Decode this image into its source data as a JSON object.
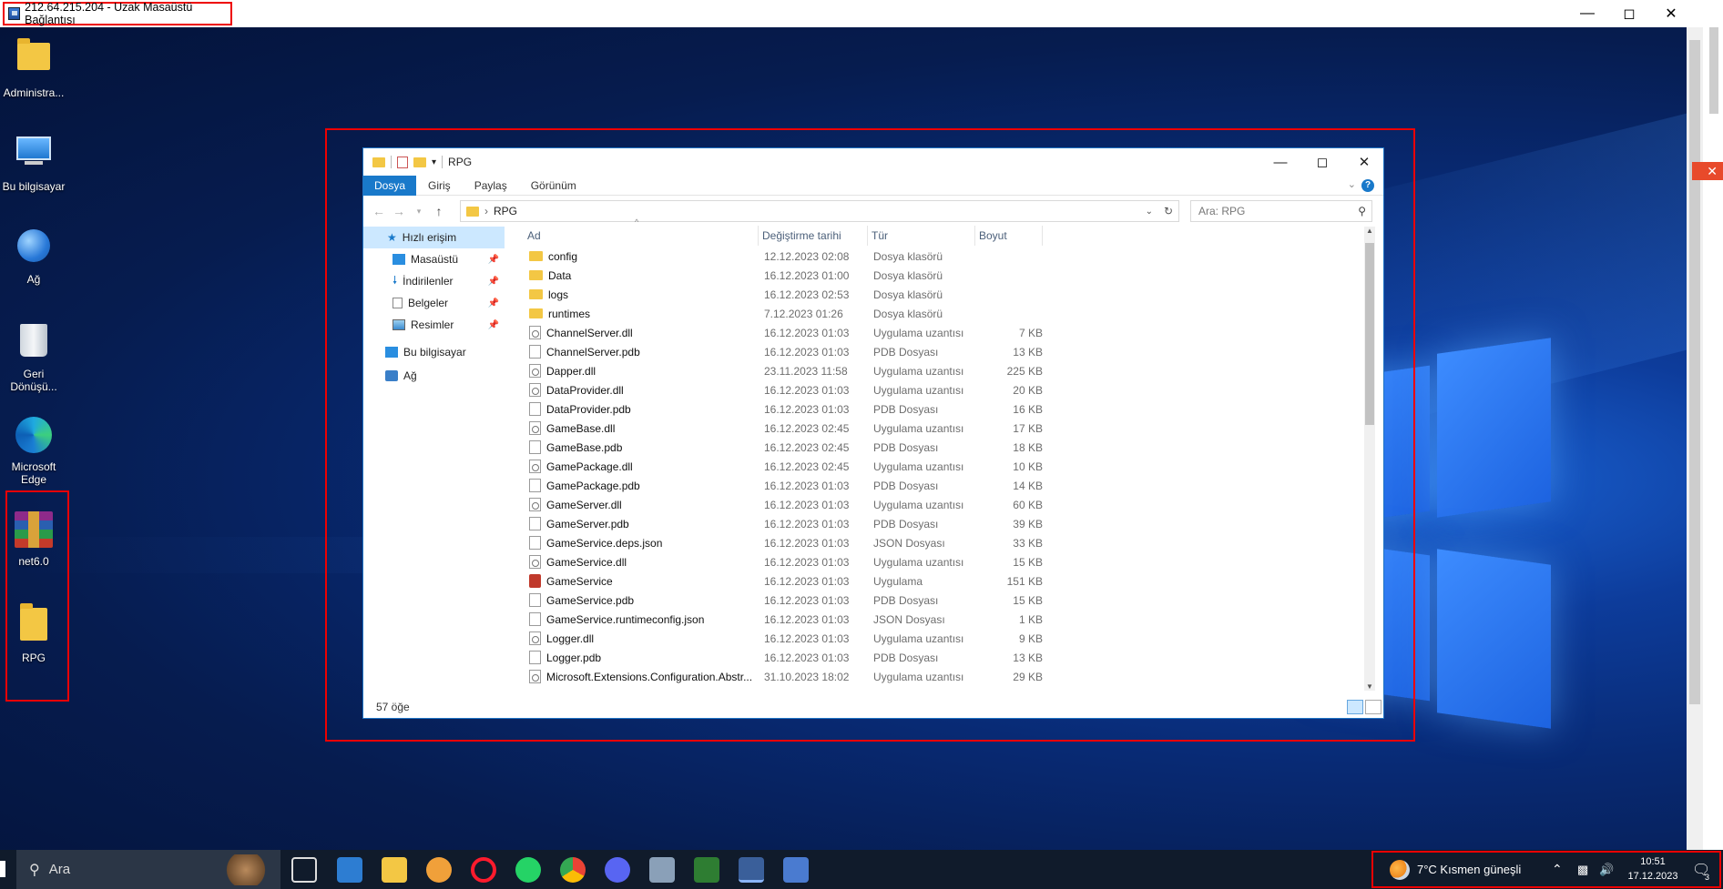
{
  "rdp": {
    "title": "212.64.215.204 - Uzak Masaüstü Bağlantısı"
  },
  "desktop": {
    "icons": [
      {
        "label": "Administra...",
        "icon": "user-folder-icon"
      },
      {
        "label": "Bu bilgisayar",
        "icon": "computer-icon"
      },
      {
        "label": "Ağ",
        "icon": "network-globe-icon"
      },
      {
        "label": "Geri Dönüşü...",
        "icon": "recycle-bin-icon"
      },
      {
        "label": "Microsoft Edge",
        "icon": "edge-icon"
      },
      {
        "label": "net6.0",
        "icon": "winrar-archive-icon"
      },
      {
        "label": "RPG",
        "icon": "folder-icon"
      }
    ]
  },
  "explorer": {
    "title": "RPG",
    "ribbon_tabs": [
      "Dosya",
      "Giriş",
      "Paylaş",
      "Görünüm"
    ],
    "address": "RPG",
    "search_placeholder": "Ara: RPG",
    "nav": {
      "quick_access": "Hızlı erişim",
      "desktop": "Masaüstü",
      "downloads": "İndirilenler",
      "documents": "Belgeler",
      "pictures": "Resimler",
      "this_pc": "Bu bilgisayar",
      "network": "Ağ"
    },
    "columns": {
      "name": "Ad",
      "date": "Değiştirme tarihi",
      "type": "Tür",
      "size": "Boyut"
    },
    "files": [
      {
        "name": "config",
        "date": "12.12.2023 02:08",
        "type": "Dosya klasörü",
        "size": "",
        "kind": "folder"
      },
      {
        "name": "Data",
        "date": "16.12.2023 01:00",
        "type": "Dosya klasörü",
        "size": "",
        "kind": "folder"
      },
      {
        "name": "logs",
        "date": "16.12.2023 02:53",
        "type": "Dosya klasörü",
        "size": "",
        "kind": "folder"
      },
      {
        "name": "runtimes",
        "date": "7.12.2023 01:26",
        "type": "Dosya klasörü",
        "size": "",
        "kind": "folder"
      },
      {
        "name": "ChannelServer.dll",
        "date": "16.12.2023 01:03",
        "type": "Uygulama uzantısı",
        "size": "7 KB",
        "kind": "dll"
      },
      {
        "name": "ChannelServer.pdb",
        "date": "16.12.2023 01:03",
        "type": "PDB Dosyası",
        "size": "13 KB",
        "kind": "file"
      },
      {
        "name": "Dapper.dll",
        "date": "23.11.2023 11:58",
        "type": "Uygulama uzantısı",
        "size": "225 KB",
        "kind": "dll"
      },
      {
        "name": "DataProvider.dll",
        "date": "16.12.2023 01:03",
        "type": "Uygulama uzantısı",
        "size": "20 KB",
        "kind": "dll"
      },
      {
        "name": "DataProvider.pdb",
        "date": "16.12.2023 01:03",
        "type": "PDB Dosyası",
        "size": "16 KB",
        "kind": "file"
      },
      {
        "name": "GameBase.dll",
        "date": "16.12.2023 02:45",
        "type": "Uygulama uzantısı",
        "size": "17 KB",
        "kind": "dll"
      },
      {
        "name": "GameBase.pdb",
        "date": "16.12.2023 02:45",
        "type": "PDB Dosyası",
        "size": "18 KB",
        "kind": "file"
      },
      {
        "name": "GamePackage.dll",
        "date": "16.12.2023 02:45",
        "type": "Uygulama uzantısı",
        "size": "10 KB",
        "kind": "dll"
      },
      {
        "name": "GamePackage.pdb",
        "date": "16.12.2023 01:03",
        "type": "PDB Dosyası",
        "size": "14 KB",
        "kind": "file"
      },
      {
        "name": "GameServer.dll",
        "date": "16.12.2023 01:03",
        "type": "Uygulama uzantısı",
        "size": "60 KB",
        "kind": "dll"
      },
      {
        "name": "GameServer.pdb",
        "date": "16.12.2023 01:03",
        "type": "PDB Dosyası",
        "size": "39 KB",
        "kind": "file"
      },
      {
        "name": "GameService.deps.json",
        "date": "16.12.2023 01:03",
        "type": "JSON Dosyası",
        "size": "33 KB",
        "kind": "file"
      },
      {
        "name": "GameService.dll",
        "date": "16.12.2023 01:03",
        "type": "Uygulama uzantısı",
        "size": "15 KB",
        "kind": "dll"
      },
      {
        "name": "GameService",
        "date": "16.12.2023 01:03",
        "type": "Uygulama",
        "size": "151 KB",
        "kind": "app"
      },
      {
        "name": "GameService.pdb",
        "date": "16.12.2023 01:03",
        "type": "PDB Dosyası",
        "size": "15 KB",
        "kind": "file"
      },
      {
        "name": "GameService.runtimeconfig.json",
        "date": "16.12.2023 01:03",
        "type": "JSON Dosyası",
        "size": "1 KB",
        "kind": "file"
      },
      {
        "name": "Logger.dll",
        "date": "16.12.2023 01:03",
        "type": "Uygulama uzantısı",
        "size": "9 KB",
        "kind": "dll"
      },
      {
        "name": "Logger.pdb",
        "date": "16.12.2023 01:03",
        "type": "PDB Dosyası",
        "size": "13 KB",
        "kind": "file"
      },
      {
        "name": "Microsoft.Extensions.Configuration.Abstr...",
        "date": "31.10.2023 18:02",
        "type": "Uygulama uzantısı",
        "size": "29 KB",
        "kind": "dll"
      }
    ],
    "status": "57 öğe"
  },
  "taskbar": {
    "search_label": "Ara",
    "weather": "7°C  Kısmen güneşli",
    "time": "10:51",
    "date": "17.12.2023",
    "notification_count": "3"
  }
}
